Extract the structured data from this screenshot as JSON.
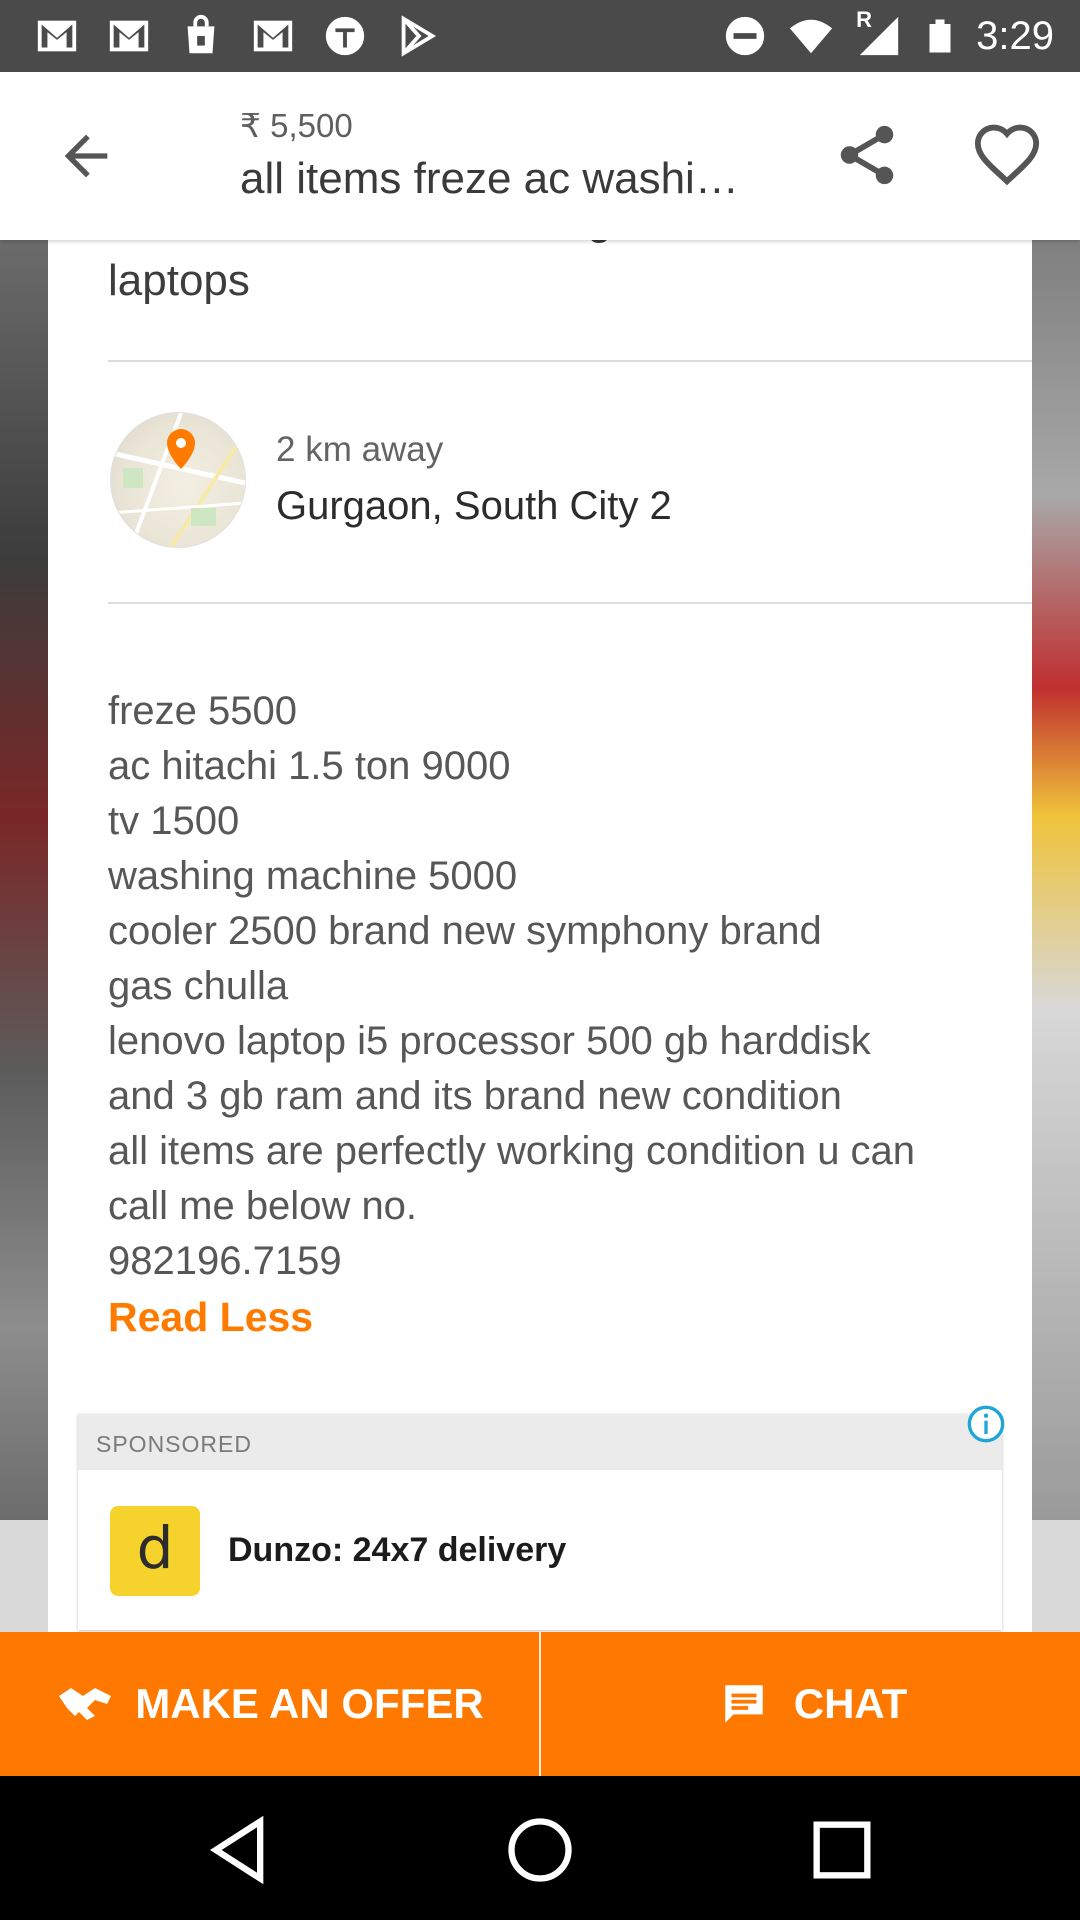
{
  "status_bar": {
    "time": "3:29",
    "icons": [
      "gmail-icon",
      "gmail-icon",
      "shopping-bag-icon",
      "gmail-icon",
      "circle-t-icon",
      "play-store-icon",
      "do-not-disturb-icon",
      "wifi-icon",
      "signal-icon",
      "battery-icon"
    ],
    "signal_roaming": "R"
  },
  "app_bar": {
    "price": "₹ 5,500",
    "title": "all items freze ac washing machine and laptops"
  },
  "listing": {
    "description_header": "laptops",
    "description_header_ghost": "all items freze ac washing machine and",
    "location": {
      "distance": "2 km away",
      "place": "Gurgaon, South City 2"
    },
    "description_lines": [
      "freze 5500",
      "ac hitachi 1.5 ton 9000",
      "tv 1500",
      "washing machine 5000",
      "cooler 2500 brand new symphony brand",
      "gas chulla",
      "lenovo laptop i5 processor 500 gb harddisk",
      "and 3 gb ram and its brand new condition",
      "all items are perfectly working condition u can",
      "call me below no.",
      "982196.7159"
    ],
    "read_less": "Read Less"
  },
  "sponsored": {
    "label": "SPONSORED",
    "logo_letter": "d",
    "title": "Dunzo: 24x7 delivery"
  },
  "actions": {
    "offer_label": "MAKE AN OFFER",
    "chat_label": "CHAT"
  },
  "colors": {
    "accent": "#ff7800",
    "read_less": "#ff7b00",
    "ad_logo": "#f6d22c"
  }
}
